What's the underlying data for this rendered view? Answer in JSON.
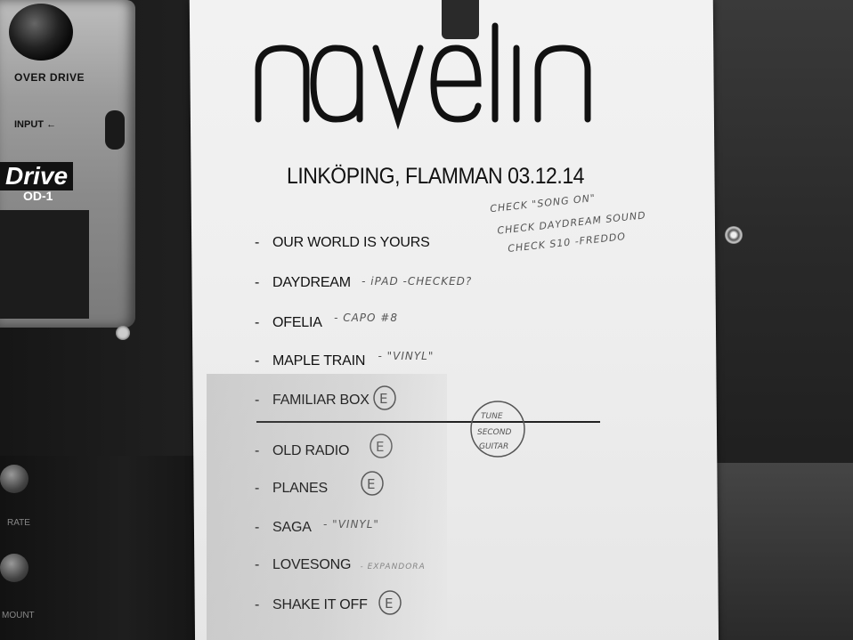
{
  "pedal": {
    "model_label": "OVER DRIVE",
    "input_label": "INPUT",
    "brand_text": "Drive",
    "model_code": "OD-1"
  },
  "lower_panel": {
    "rate_label": "RATE",
    "amount_label": "MOUNT"
  },
  "setlist": {
    "band": "navelin",
    "venue_line": "LINKÖPING, FLAMMAN 03.12.14",
    "songs_set1": [
      {
        "title": "OUR WORLD IS YOURS",
        "note": ""
      },
      {
        "title": "DAYDREAM",
        "note": "- iPAD -CHECKED?"
      },
      {
        "title": "OFELIA",
        "note": "- CAPO #8"
      },
      {
        "title": "MAPLE TRAIN",
        "note": "- \"VINYL\""
      },
      {
        "title": "FAMILIAR BOX",
        "note": ""
      }
    ],
    "songs_set2": [
      {
        "title": "OLD RADIO",
        "note": ""
      },
      {
        "title": "PLANES",
        "note": ""
      },
      {
        "title": "SAGA",
        "note": "- \"VINYL\""
      },
      {
        "title": "LOVESONG",
        "note": "- EXPANDORA"
      },
      {
        "title": "SHAKE IT OFF",
        "note": ""
      }
    ],
    "handwritten_checks": [
      "CHECK \"SONG ON\"",
      "CHECK DAYDREAM SOUND",
      "CHECK S10 -FREDDO"
    ],
    "tune_note": [
      "TUNE",
      "SECOND",
      "GUITAR"
    ],
    "e_mark": "E"
  }
}
